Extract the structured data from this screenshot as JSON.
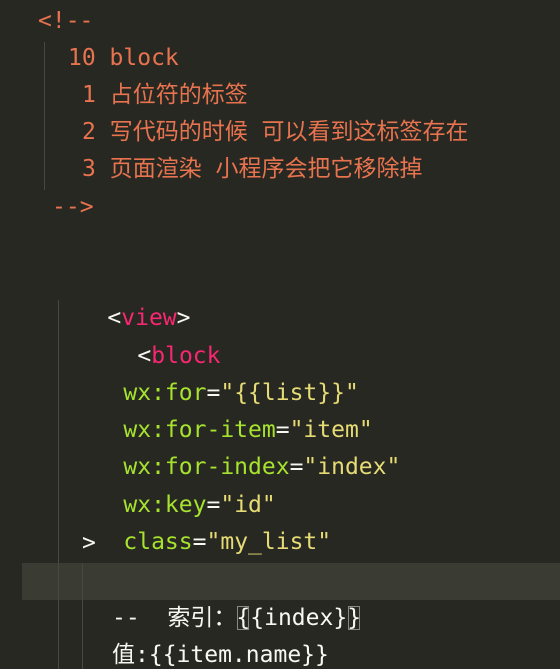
{
  "editor": {
    "lines": {
      "comment_open": "<!--",
      "comment_1": "10 block",
      "comment_2": "1 占位符的标签",
      "comment_3": "2 写代码的时候 可以看到这标签存在",
      "comment_4": "3 页面渲染 小程序会把它移除掉",
      "comment_close": "-->",
      "view_lt": "<",
      "view_tag": "view",
      "view_gt": ">",
      "block_lt": "<",
      "block_tag": "block",
      "attr_for_name": "wx:for",
      "attr_for_eq": "=",
      "attr_for_val": "\"{{list}}\"",
      "attr_item_name": "wx:for-item",
      "attr_item_eq": "=",
      "attr_item_val": "\"item\"",
      "attr_index_name": "wx:for-index",
      "attr_index_eq": "=",
      "attr_index_val": "\"index\"",
      "attr_key_name": "wx:key",
      "attr_key_eq": "=",
      "attr_key_val": "\"id\"",
      "attr_class_name": "class",
      "attr_class_eq": "=",
      "attr_class_val": "\"my_list\"",
      "block_close_gt": ">",
      "text_index_label": "索引：",
      "text_index_open": "{",
      "text_index_expr": "{index}",
      "text_index_close": "}",
      "text_dash": "--",
      "text_value": "值:{{item.name}}"
    },
    "colors": {
      "background": "#272822",
      "comment": "#e8734f",
      "tag": "#f92672",
      "attribute": "#a6e22e",
      "string": "#e6db74",
      "plain": "#f8f8f2"
    }
  }
}
